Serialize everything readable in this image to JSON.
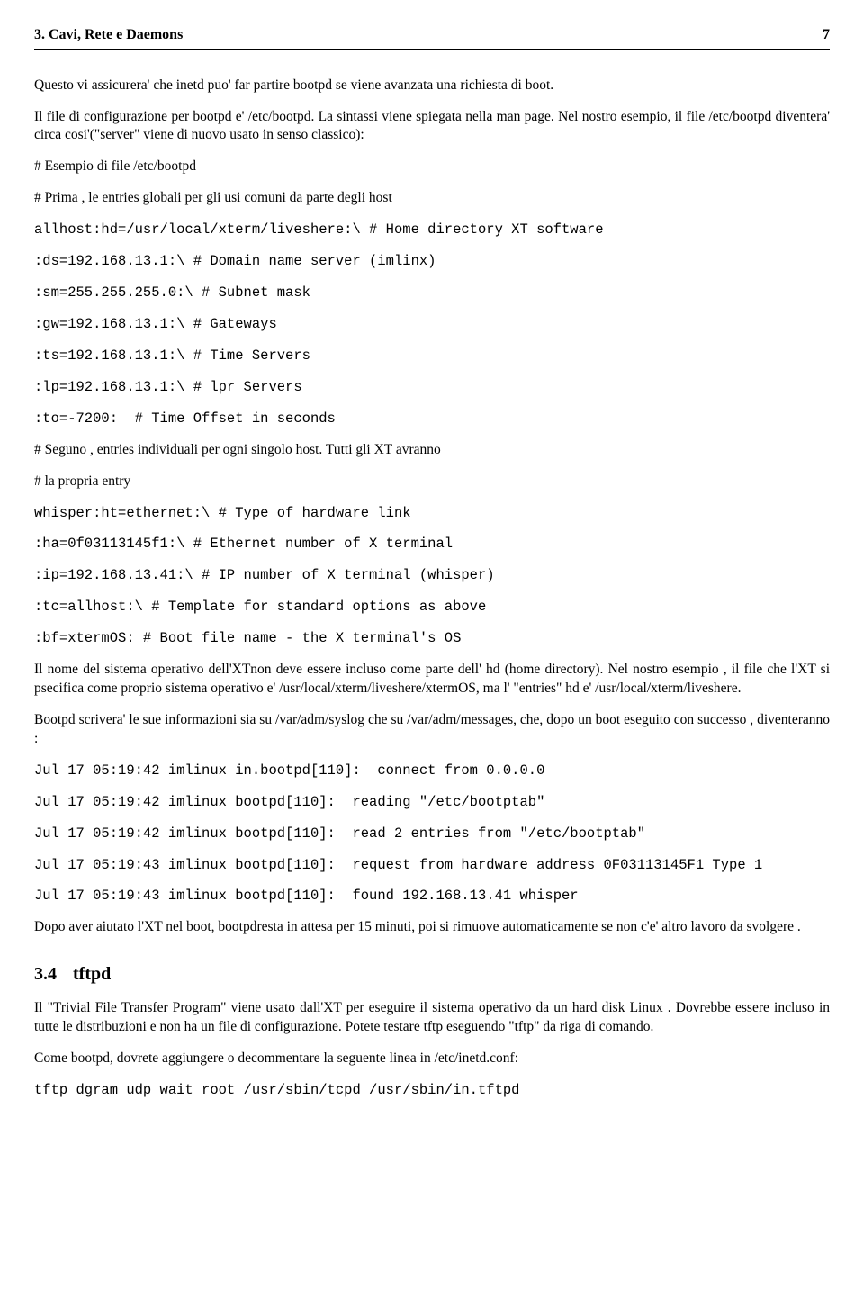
{
  "header": {
    "left": "3.   Cavi, Rete e Daemons",
    "right": "7"
  },
  "para": {
    "p1": "Questo vi assicurera' che inetd puo' far partire bootpd se viene avanzata una richiesta di boot.",
    "p2": "Il file di configurazione per bootpd e' /etc/bootpd. La sintassi viene spiegata nella man page. Nel nostro esempio, il file /etc/bootpd diventera' circa cosi'(\"server\" viene di nuovo usato in senso classico):",
    "c1": "# Esempio di file /etc/bootpd",
    "c2": "# Prima , le entries globali per gli usi comuni da parte degli host",
    "c3": "allhost:hd=/usr/local/xterm/liveshere:\\ # Home directory XT software",
    "c4": ":ds=192.168.13.1:\\ # Domain name server (imlinx)",
    "c5": ":sm=255.255.255.0:\\ # Subnet mask",
    "c6": ":gw=192.168.13.1:\\ # Gateways",
    "c7": ":ts=192.168.13.1:\\ # Time Servers",
    "c8": ":lp=192.168.13.1:\\ # lpr Servers",
    "c9": ":to=-7200:  # Time Offset in seconds",
    "c10": "# Seguno , entries individuali per ogni singolo host. Tutti gli XT avranno",
    "c11": "# la propria entry",
    "c12": "whisper:ht=ethernet:\\ # Type of hardware link",
    "c13": ":ha=0f03113145f1:\\ # Ethernet number of X terminal",
    "c14": ":ip=192.168.13.41:\\ # IP number of X terminal (whisper)",
    "c15": ":tc=allhost:\\ # Template for standard options as above",
    "c16": ":bf=xtermOS: # Boot file name - the X terminal's OS",
    "p3": "Il nome del sistema operativo dell'XTnon deve essere incluso come parte dell' hd (home directory). Nel nostro esempio , il file che l'XT si psecifica come proprio sistema operativo e' /usr/local/xterm/liveshere/xtermOS, ma l' \"entries\" hd e' /usr/local/xterm/liveshere.",
    "p4": "Bootpd scrivera' le sue informazioni sia su /var/adm/syslog che su /var/adm/messages, che, dopo un boot eseguito con successo , diventeranno :",
    "l1": "Jul 17 05:19:42 imlinux in.bootpd[110]:  connect from 0.0.0.0",
    "l2": "Jul 17 05:19:42 imlinux bootpd[110]:  reading \"/etc/bootptab\"",
    "l3": "Jul 17 05:19:42 imlinux bootpd[110]:  read 2 entries from \"/etc/bootptab\"",
    "l4": "Jul 17 05:19:43 imlinux bootpd[110]:  request from hardware address 0F03113145F1 Type 1",
    "l5": "Jul 17 05:19:43 imlinux bootpd[110]:  found 192.168.13.41 whisper",
    "p5": "Dopo aver aiutato l'XT nel boot, bootpdresta in attesa per 15 minuti, poi si rimuove automaticamente se non c'e' altro lavoro da svolgere .",
    "sec_num": "3.4",
    "sec_title": "tftpd",
    "p6": "Il \"Trivial File Transfer Program\" viene usato dall'XT per eseguire il sistema operativo da un hard disk Linux . Dovrebbe essere incluso in tutte le distribuzioni e non ha un file di configurazione. Potete testare tftp eseguendo \"tftp\" da riga di comando.",
    "p7": "Come bootpd, dovrete aggiungere o decommentare la seguente linea in /etc/inetd.conf:",
    "c17": "tftp dgram udp wait root /usr/sbin/tcpd /usr/sbin/in.tftpd"
  }
}
